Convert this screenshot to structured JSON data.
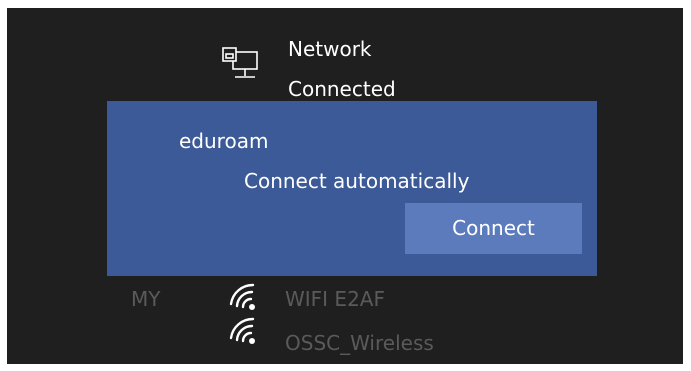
{
  "network": {
    "title": "Network",
    "status": "Connected",
    "icon": "ethernet-icon"
  },
  "popup": {
    "ssid": "eduroam",
    "auto_label": "Connect automatically",
    "connect_label": "Connect",
    "background": "#3d5a98",
    "button_color": "#5b7bbd"
  },
  "list": {
    "left_label": "MY",
    "items": [
      {
        "name": "WIFI E2AF",
        "icon": "wifi-icon"
      },
      {
        "name": "OSSC_Wireless",
        "icon": "wifi-icon"
      }
    ]
  }
}
